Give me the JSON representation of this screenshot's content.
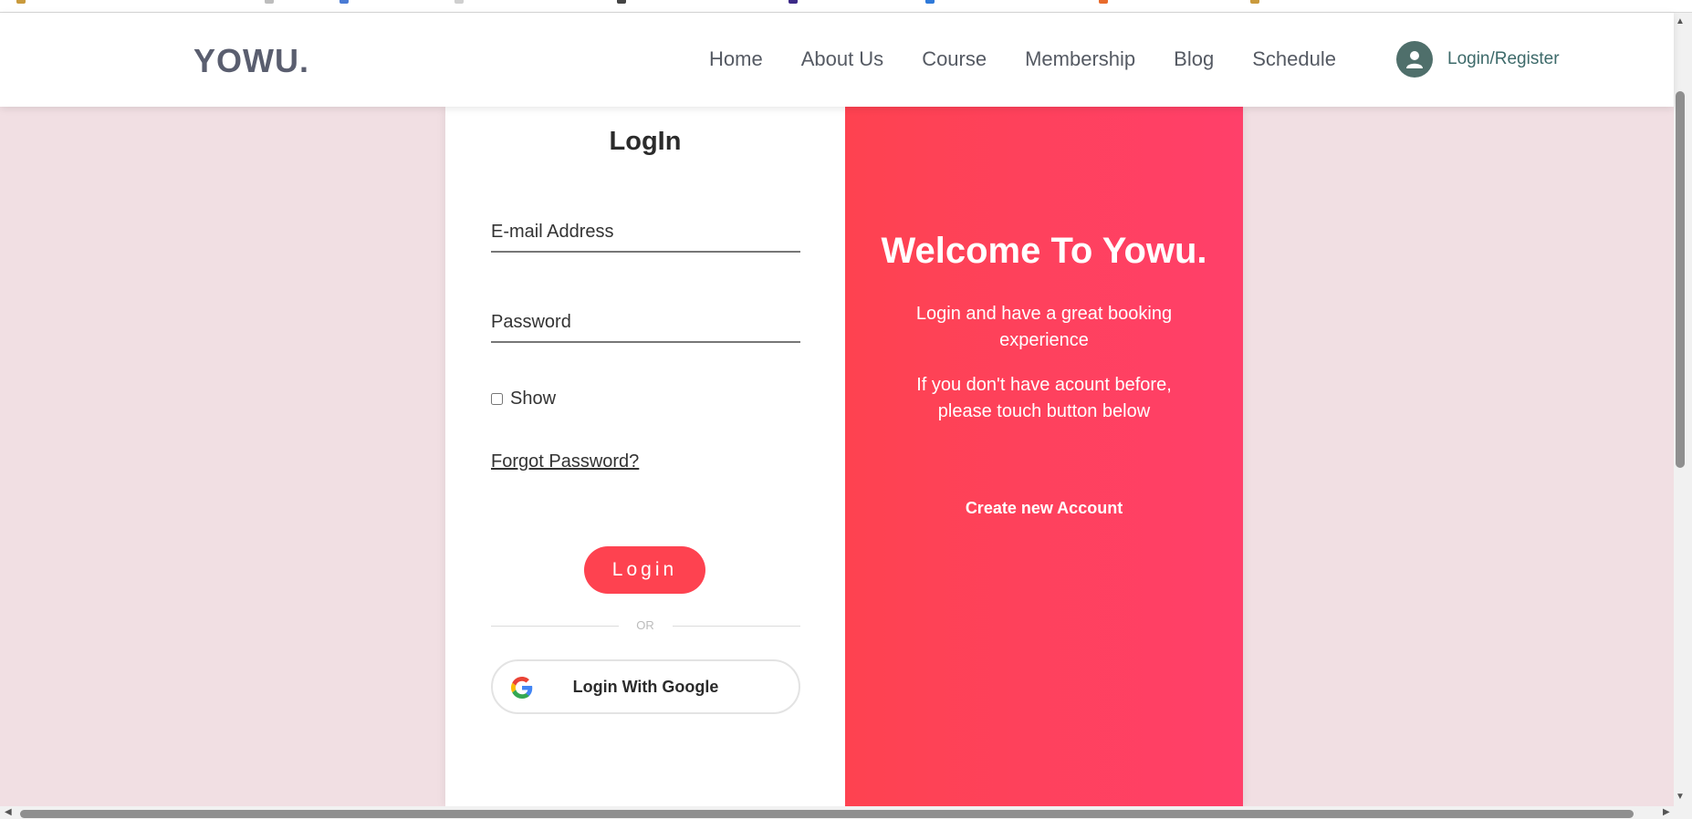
{
  "brand": {
    "logo": "YOWU."
  },
  "nav": {
    "links": [
      {
        "label": "Home"
      },
      {
        "label": "About Us"
      },
      {
        "label": "Course"
      },
      {
        "label": "Membership"
      },
      {
        "label": "Blog"
      },
      {
        "label": "Schedule"
      }
    ],
    "user_icon": "user-icon",
    "login_register": "Login/Register"
  },
  "login_form": {
    "title": "LogIn",
    "email_placeholder": "E-mail Address",
    "password_placeholder": "Password",
    "show_label": "Show",
    "forgot_password": "Forgot Password?",
    "login_button": "Login",
    "or_text": "OR",
    "google_button": "Login With Google",
    "google_icon": "google-icon"
  },
  "welcome": {
    "title": "Welcome To Yowu.",
    "text1": "Login and have a great booking experience",
    "text2": "If you don't have acount before, please touch button below",
    "create_account": "Create new Account"
  },
  "colors": {
    "accent": "#fe4250",
    "gradient_end": "#ff406a",
    "page_background": "#f1dfe3",
    "avatar": "#4f6f6b"
  }
}
